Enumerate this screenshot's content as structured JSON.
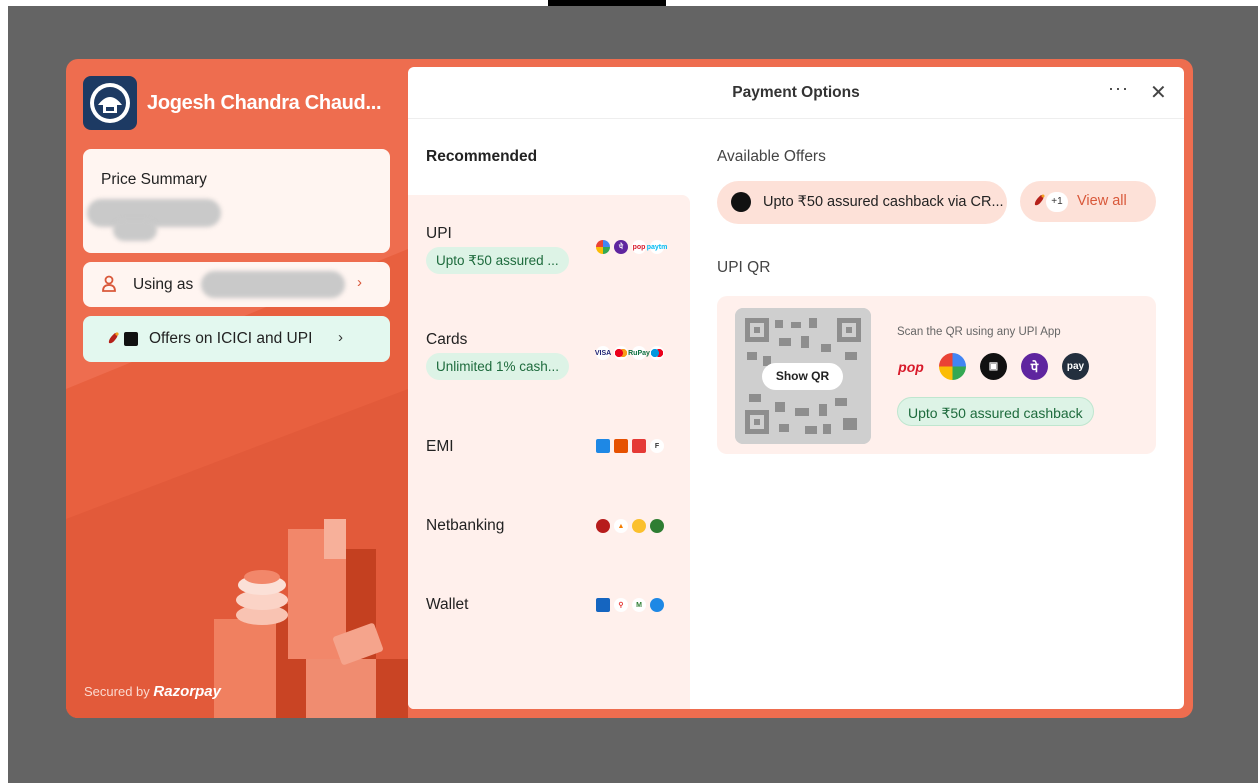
{
  "merchant": {
    "name": "Jogesh Chandra Chaud..."
  },
  "left_panel": {
    "price_summary_label": "Price Summary",
    "using_as_label": "Using as",
    "offers_label": "Offers on ICICI and UPI",
    "chevron": "›",
    "secured_prefix": "Secured by",
    "secured_brand": "Razorpay"
  },
  "header": {
    "title": "Payment Options",
    "more_label": "···",
    "close_label": "✕"
  },
  "recommended_title": "Recommended",
  "methods": [
    {
      "name": "UPI",
      "badge": "Upto ₹50 assured ..."
    },
    {
      "name": "Cards",
      "badge": "Unlimited 1% cash..."
    },
    {
      "name": "EMI",
      "badge": ""
    },
    {
      "name": "Netbanking",
      "badge": ""
    },
    {
      "name": "Wallet",
      "badge": ""
    }
  ],
  "offers": {
    "title": "Available Offers",
    "primary": "Upto ₹50 assured cashback via CR...",
    "plus_count": "+1",
    "view_all": "View all"
  },
  "upi_qr": {
    "title": "UPI QR",
    "show_qr": "Show QR",
    "scan_text": "Scan the QR using any UPI App",
    "badge": "Upto ₹50 assured cashback",
    "apps": [
      "pop",
      "gpay",
      "cred",
      "phonepe",
      "amazonpay"
    ],
    "amazon_label": "pay"
  },
  "colors": {
    "brand": "#ee6d4f",
    "accent_text": "#d9583a",
    "green_badge": "#ddf3e6"
  }
}
